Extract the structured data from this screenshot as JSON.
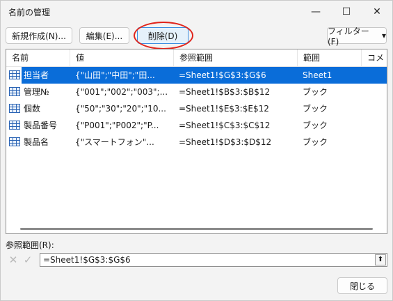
{
  "window": {
    "title": "名前の管理",
    "minimize_glyph": "—",
    "maximize_glyph": "☐",
    "close_glyph": "✕"
  },
  "toolbar": {
    "new_label": "新規作成(N)...",
    "edit_label": "編集(E)...",
    "delete_label": "削除(D)",
    "filter_label": "フィルター(F)",
    "filter_arrow": "▾"
  },
  "table": {
    "columns": [
      "名前",
      "値",
      "参照範囲",
      "範囲",
      "コメ"
    ],
    "rows": [
      {
        "name": "担当者",
        "value": "{\"山田\";\"中田\";\"田...",
        "ref": "=Sheet1!$G$3:$G$6",
        "scope": "Sheet1",
        "selected": true
      },
      {
        "name": "管理№",
        "value": "{\"001\";\"002\";\"003\";...",
        "ref": "=Sheet1!$B$3:$B$12",
        "scope": "ブック",
        "selected": false
      },
      {
        "name": "個数",
        "value": "{\"50\";\"30\";\"20\";\"10...",
        "ref": "=Sheet1!$E$3:$E$12",
        "scope": "ブック",
        "selected": false
      },
      {
        "name": "製品番号",
        "value": "{\"P001\";\"P002\";\"P...",
        "ref": "=Sheet1!$C$3:$C$12",
        "scope": "ブック",
        "selected": false
      },
      {
        "name": "製品名",
        "value": "{\"スマートフォン\"...",
        "ref": "=Sheet1!$D$3:$D$12",
        "scope": "ブック",
        "selected": false
      }
    ]
  },
  "refers_to": {
    "label": "参照範囲(R):",
    "value": "=Sheet1!$G$3:$G$6",
    "cancel_glyph": "✕",
    "confirm_glyph": "✓",
    "collapse_glyph": "⬆"
  },
  "footer": {
    "close_label": "閉じる"
  },
  "colors": {
    "selection": "#0a6dd9",
    "highlight_circle": "#e0231a",
    "selected_button_border": "#3c8ee0"
  }
}
